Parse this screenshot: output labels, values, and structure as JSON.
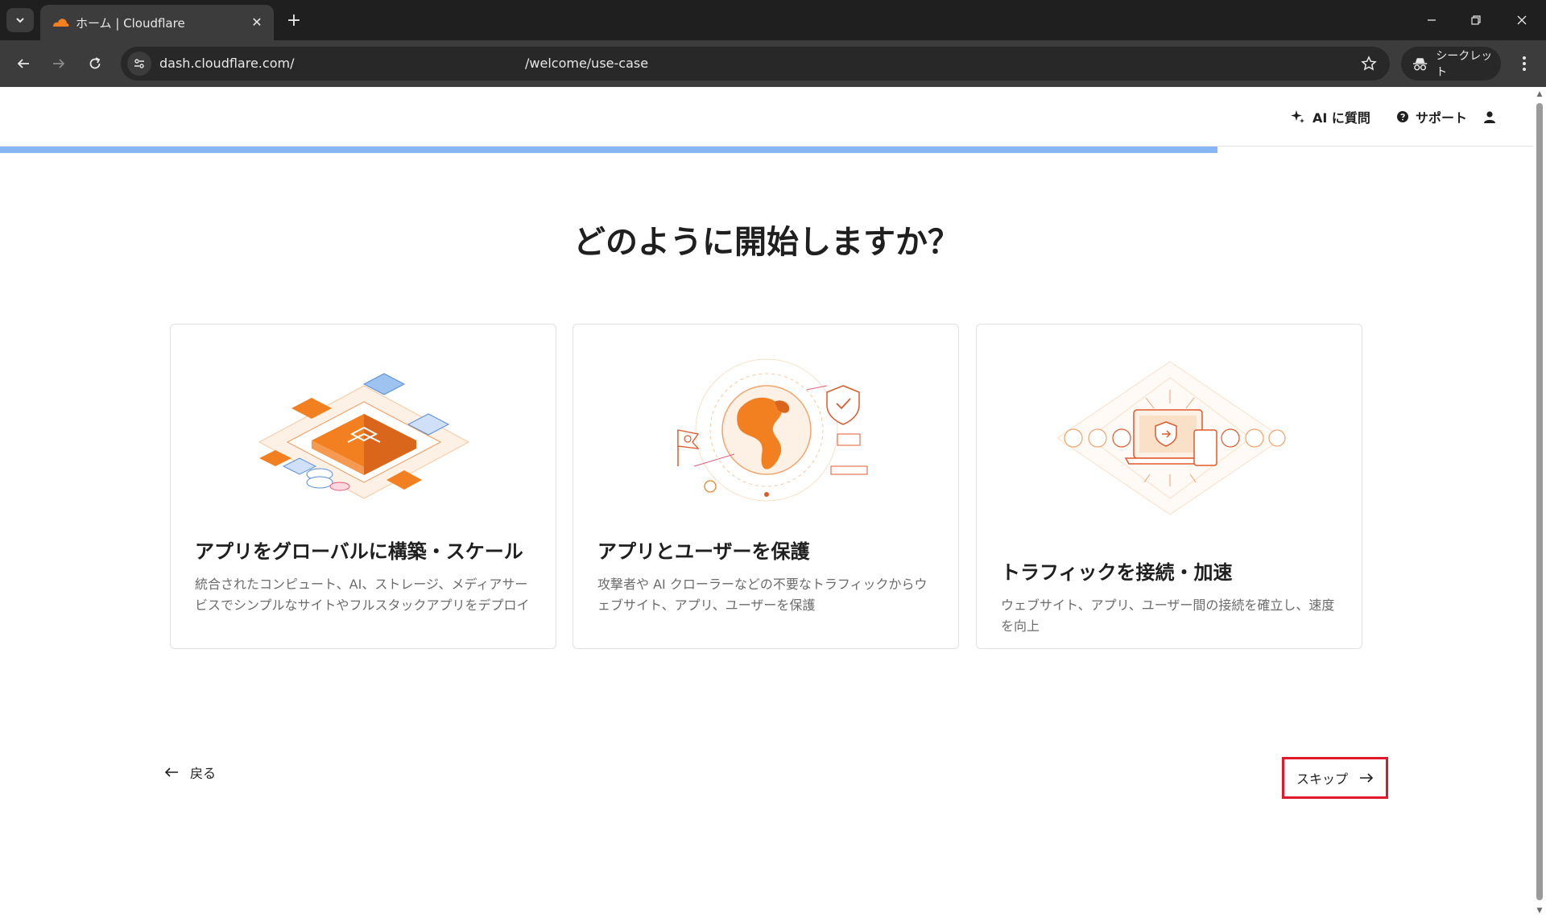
{
  "browser": {
    "tab_title": "ホーム | Cloudflare",
    "url_host": "dash.cloudflare.com/",
    "url_path": "/welcome/use-case",
    "incognito_label": "シークレット",
    "new_tab_glyph": "+",
    "close_glyph": "✕"
  },
  "header": {
    "ask_ai": "AI に質問",
    "support": "サポート"
  },
  "progress": {
    "fraction": 0.794
  },
  "question": "どのように開始しますか？",
  "cards": [
    {
      "title": "アプリをグローバルに構築・スケール",
      "description": "統合されたコンピュート、AI、ストレージ、メディアサービスでシンプルなサイトやフルスタックアプリをデプロイ"
    },
    {
      "title": "アプリとユーザーを保護",
      "description": "攻撃者や AI クローラーなどの不要なトラフィックからウェブサイト、アプリ、ユーザーを保護"
    },
    {
      "title": "トラフィックを接続・加速",
      "description": "ウェブサイト、アプリ、ユーザー間の接続を確立し、速度を向上"
    }
  ],
  "footer": {
    "back_label": "戻る",
    "skip_label": "スキップ"
  },
  "colors": {
    "accent_orange": "#f38020",
    "progress_blue": "#86b7f4",
    "highlight_red": "#e0192a"
  },
  "icons": [
    "tab-list-icon",
    "cloudflare-favicon",
    "close-icon",
    "plus-icon",
    "minimize-icon",
    "restore-icon",
    "back-arrow-icon",
    "forward-arrow-icon",
    "reload-icon",
    "site-info-icon",
    "star-icon",
    "incognito-icon",
    "kebab-menu-icon",
    "sparkle-icon",
    "help-circle-icon",
    "user-icon",
    "arrow-left-icon",
    "arrow-right-icon"
  ]
}
